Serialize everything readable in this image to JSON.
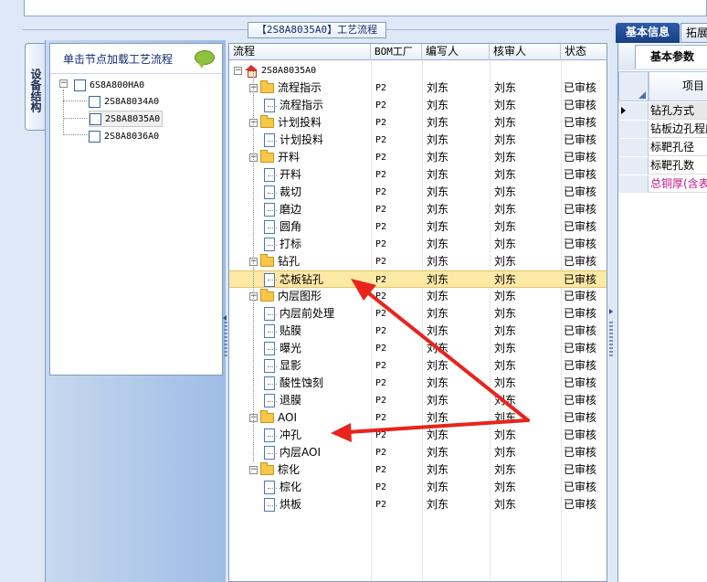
{
  "panel": {
    "title": "【2S8A8035A0】工艺流程"
  },
  "left": {
    "vertical_tab": "设备结构",
    "hint": "单击节点加载工艺流程",
    "tree": {
      "root": "6S8A800HA0",
      "children": [
        "2S8A8034A0",
        "2S8A8035A0",
        "2S8A8036A0"
      ],
      "selected": "2S8A8035A0"
    }
  },
  "grid": {
    "columns": [
      "流程",
      "BOM工厂",
      "编写人",
      "核审人",
      "状态"
    ],
    "root": "2S8A8035A0",
    "rows": [
      {
        "name": "流程指示",
        "level": 1,
        "type": "folder",
        "bom": "P2",
        "writer": "刘东",
        "reviewer": "刘东",
        "status": "已审核"
      },
      {
        "name": "流程指示",
        "level": 2,
        "type": "doc",
        "bom": "P2",
        "writer": "刘东",
        "reviewer": "刘东",
        "status": "已审核"
      },
      {
        "name": "计划投料",
        "level": 1,
        "type": "folder",
        "bom": "P2",
        "writer": "刘东",
        "reviewer": "刘东",
        "status": "已审核"
      },
      {
        "name": "计划投料",
        "level": 2,
        "type": "doc",
        "bom": "P2",
        "writer": "刘东",
        "reviewer": "刘东",
        "status": "已审核"
      },
      {
        "name": "开料",
        "level": 1,
        "type": "folder",
        "bom": "P2",
        "writer": "刘东",
        "reviewer": "刘东",
        "status": "已审核"
      },
      {
        "name": "开料",
        "level": 2,
        "type": "doc",
        "bom": "P2",
        "writer": "刘东",
        "reviewer": "刘东",
        "status": "已审核"
      },
      {
        "name": "裁切",
        "level": 2,
        "type": "doc",
        "bom": "P2",
        "writer": "刘东",
        "reviewer": "刘东",
        "status": "已审核"
      },
      {
        "name": "磨边",
        "level": 2,
        "type": "doc",
        "bom": "P2",
        "writer": "刘东",
        "reviewer": "刘东",
        "status": "已审核"
      },
      {
        "name": "圆角",
        "level": 2,
        "type": "doc",
        "bom": "P2",
        "writer": "刘东",
        "reviewer": "刘东",
        "status": "已审核"
      },
      {
        "name": "打标",
        "level": 2,
        "type": "doc",
        "bom": "P2",
        "writer": "刘东",
        "reviewer": "刘东",
        "status": "已审核"
      },
      {
        "name": "钻孔",
        "level": 1,
        "type": "folder",
        "bom": "P2",
        "writer": "刘东",
        "reviewer": "刘东",
        "status": "已审核"
      },
      {
        "name": "芯板钻孔",
        "level": 2,
        "type": "doc",
        "bom": "P2",
        "writer": "刘东",
        "reviewer": "刘东",
        "status": "已审核",
        "selected": true
      },
      {
        "name": "内层图形",
        "level": 1,
        "type": "folder",
        "bom": "P2",
        "writer": "刘东",
        "reviewer": "刘东",
        "status": "已审核"
      },
      {
        "name": "内层前处理",
        "level": 2,
        "type": "doc",
        "bom": "P2",
        "writer": "刘东",
        "reviewer": "刘东",
        "status": "已审核"
      },
      {
        "name": "贴膜",
        "level": 2,
        "type": "doc",
        "bom": "P2",
        "writer": "刘东",
        "reviewer": "刘东",
        "status": "已审核"
      },
      {
        "name": "曝光",
        "level": 2,
        "type": "doc",
        "bom": "P2",
        "writer": "刘东",
        "reviewer": "刘东",
        "status": "已审核"
      },
      {
        "name": "显影",
        "level": 2,
        "type": "doc",
        "bom": "P2",
        "writer": "刘东",
        "reviewer": "刘东",
        "status": "已审核"
      },
      {
        "name": "酸性蚀刻",
        "level": 2,
        "type": "doc",
        "bom": "P2",
        "writer": "刘东",
        "reviewer": "刘东",
        "status": "已审核"
      },
      {
        "name": "退膜",
        "level": 2,
        "type": "doc",
        "bom": "P2",
        "writer": "刘东",
        "reviewer": "刘东",
        "status": "已审核"
      },
      {
        "name": "AOI",
        "level": 1,
        "type": "folder",
        "bom": "P2",
        "writer": "刘东",
        "reviewer": "刘东",
        "status": "已审核"
      },
      {
        "name": "冲孔",
        "level": 2,
        "type": "doc",
        "bom": "P2",
        "writer": "刘东",
        "reviewer": "刘东",
        "status": "已审核"
      },
      {
        "name": "内层AOI",
        "level": 2,
        "type": "doc",
        "bom": "P2",
        "writer": "刘东",
        "reviewer": "刘东",
        "status": "已审核"
      },
      {
        "name": "棕化",
        "level": 1,
        "type": "folder",
        "bom": "P2",
        "writer": "刘东",
        "reviewer": "刘东",
        "status": "已审核"
      },
      {
        "name": "棕化",
        "level": 2,
        "type": "doc",
        "bom": "P2",
        "writer": "刘东",
        "reviewer": "刘东",
        "status": "已审核"
      },
      {
        "name": "烘板",
        "level": 2,
        "type": "doc",
        "bom": "P2",
        "writer": "刘东",
        "reviewer": "刘东",
        "status": "已审核"
      }
    ]
  },
  "right": {
    "tabs": [
      "基本信息",
      "拓展"
    ],
    "subtab": "基本参数",
    "column_header": "项目",
    "rows": [
      "钻孔方式",
      "钻板边孔程序",
      "标靶孔径",
      "标靶孔数",
      "总铜厚(含表"
    ],
    "highlight_color": "#c0178a"
  },
  "annotation": {
    "arrow_color": "#e8241c"
  }
}
